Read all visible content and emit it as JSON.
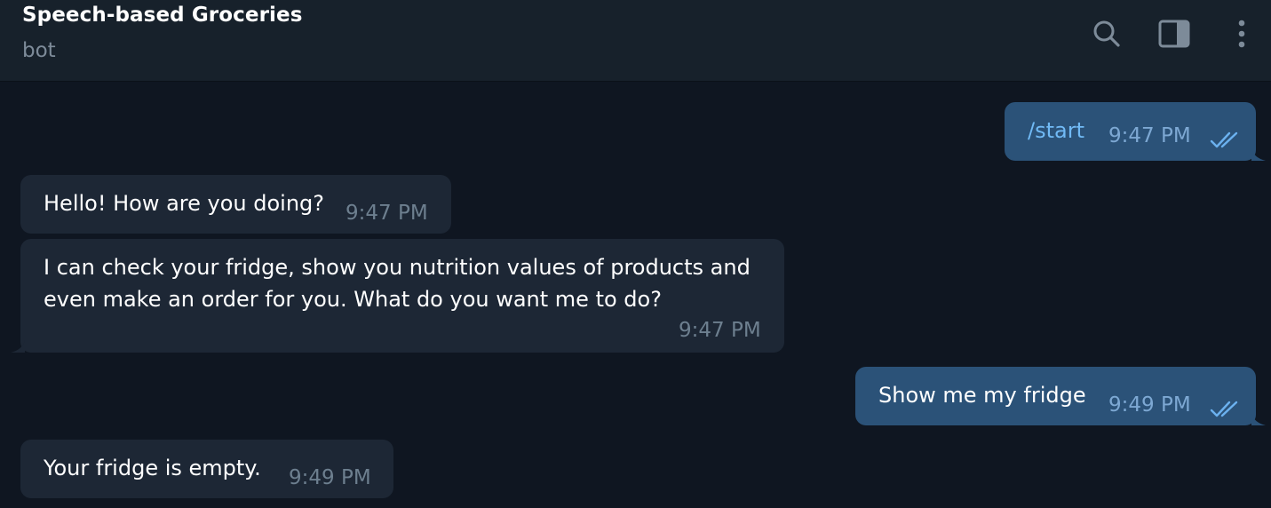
{
  "header": {
    "title": "Speech-based Groceries",
    "subtitle": "bot",
    "icons": [
      "search-icon",
      "sidebar-toggle-icon",
      "more-vertical-icon"
    ]
  },
  "messages": [
    {
      "direction": "outgoing",
      "text": "/start",
      "time": "9:47 PM",
      "status": "read"
    },
    {
      "direction": "incoming",
      "text": "Hello! How are you doing?",
      "time": "9:47 PM"
    },
    {
      "direction": "incoming",
      "lines": [
        "I can check your fridge, show you nutrition values of products and",
        "even make an order for you. What do you want me to do?"
      ],
      "time": "9:47 PM"
    },
    {
      "direction": "outgoing",
      "text": "Show me my fridge",
      "time": "9:49 PM",
      "status": "read"
    },
    {
      "direction": "incoming",
      "text": "Your fridge is empty.",
      "time": "9:49 PM"
    }
  ],
  "colors": {
    "background": "#0f1621",
    "header": "#17212b",
    "incoming_bubble": "#1d2735",
    "outgoing_bubble": "#2b5278",
    "command_link": "#71baf5",
    "read_ticks": "#6bb1ef"
  }
}
